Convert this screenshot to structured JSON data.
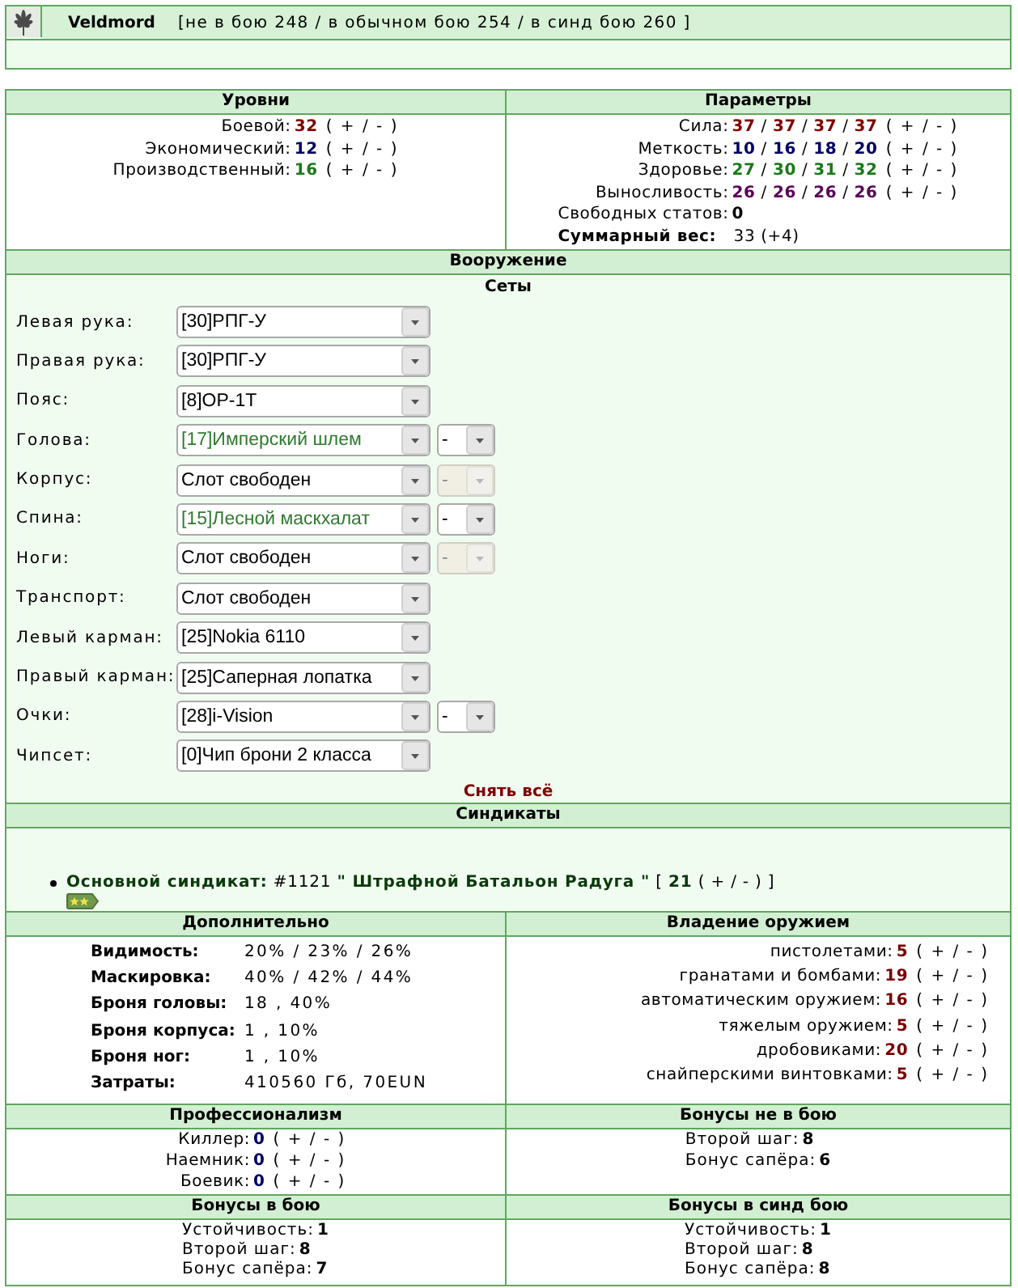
{
  "header": {
    "name": "Veldmord",
    "levels_text": "[не в бою 248 / в обычном бою 254 / в синд бою 260 ]"
  },
  "levels": {
    "title": "Уровни",
    "rows": [
      {
        "label": "Боевой:",
        "value": "32",
        "color": "#800000",
        "adjust": "( + / - )"
      },
      {
        "label": "Экономический:",
        "value": "12",
        "color": "#000066",
        "adjust": "( + / - )"
      },
      {
        "label": "Производственный:",
        "value": "16",
        "color": "#1a7a1a",
        "adjust": "( + / - )"
      }
    ]
  },
  "params": {
    "title": "Параметры",
    "stats": [
      {
        "label": "Сила:",
        "values": "**37** / **37** / **37** / **37**",
        "color": "#800000",
        "adjust": "( + / - )"
      },
      {
        "label": "Меткость:",
        "values": "**10** / **16** / **18** / **20**",
        "color": "#000066",
        "adjust": "( + / - )"
      },
      {
        "label": "Здоровье:",
        "values": "**27** / **30** / **31** / **32**",
        "color": "#1a7a1a",
        "adjust": "( + / - )"
      },
      {
        "label": "Выносливость:",
        "values": "**26** / **26** / **26** / **26**",
        "color": "#5a005a",
        "adjust": "( + / - )"
      }
    ],
    "free_stats": {
      "label": "Свободных статов:",
      "value": "0"
    },
    "total_weight": {
      "label": "Суммарный вес:",
      "value": "33 (+4)"
    }
  },
  "armament": {
    "title": "Вооружение",
    "sets_label": "Сеты",
    "slots": [
      {
        "label": "Левая рука:",
        "item": "[30]РПГ-У",
        "color": "#000000"
      },
      {
        "label": "Правая рука:",
        "item": "[30]РПГ-У",
        "color": "#000000"
      },
      {
        "label": "Пояс:",
        "item": "[8]ОР-1Т",
        "color": "#000000"
      },
      {
        "label": "Голова:",
        "item": "[17]Имперский шлем",
        "color": "#2f7a2f",
        "mod": {
          "value": "-",
          "disabled": false
        }
      },
      {
        "label": "Корпус:",
        "item": "Слот свободен",
        "color": "#000000",
        "mod": {
          "value": "-",
          "disabled": true
        }
      },
      {
        "label": "Спина:",
        "item": "[15]Лесной маскхалат",
        "color": "#2f7a2f",
        "mod": {
          "value": "-",
          "disabled": false
        }
      },
      {
        "label": "Ноги:",
        "item": "Слот свободен",
        "color": "#000000",
        "mod": {
          "value": "-",
          "disabled": true
        }
      },
      {
        "label": "Транспорт:",
        "item": "Слот свободен",
        "color": "#000000"
      },
      {
        "label": "Левый карман:",
        "item": "[25]Nokia 6110",
        "color": "#000000"
      },
      {
        "label": "Правый карман:",
        "item": "[25]Саперная лопатка",
        "color": "#000000"
      },
      {
        "label": "Очки:",
        "item": "[28]i-Vision",
        "color": "#000000",
        "mod": {
          "value": "-",
          "disabled": false
        }
      },
      {
        "label": "Чипсет:",
        "item": "[0]Чип брони 2 класса",
        "color": "#000000"
      }
    ],
    "remove_all": "Снять всё"
  },
  "syndicates": {
    "title": "Синдикаты",
    "items": [
      {
        "text": "**Основной синдикат:** #1121 **\" Штрафной Батальон Радуга \"** [ **21** ( + / - ) ]"
      }
    ]
  },
  "extra": {
    "title": "Дополнительно",
    "rows": [
      {
        "label": "Видимость:",
        "value": "20% / 23% / 26%"
      },
      {
        "label": "Маскировка:",
        "value": "40% / 42% / 44%"
      },
      {
        "label": "Броня головы:",
        "value": "18 , 40%"
      },
      {
        "label": "Броня корпуса:",
        "value": "1 , 10%"
      },
      {
        "label": "Броня ног:",
        "value": "1 , 10%"
      },
      {
        "label": "Затраты:",
        "value": "410560 Гб, 70EUN"
      }
    ]
  },
  "weapons": {
    "title": "Владение оружием",
    "rows": [
      {
        "label": "пистолетами:",
        "value": "5",
        "adjust": "( + / - )"
      },
      {
        "label": "гранатами и бомбами:",
        "value": "19",
        "adjust": "( + / - )"
      },
      {
        "label": "автоматическим оружием:",
        "value": "16",
        "adjust": "( + / - )"
      },
      {
        "label": "тяжелым оружием:",
        "value": "5",
        "adjust": "( + / - )"
      },
      {
        "label": "дробовиками:",
        "value": "20",
        "adjust": "( + / - )"
      },
      {
        "label": "снайперскими винтовками:",
        "value": "5",
        "adjust": "( + / - )"
      }
    ]
  },
  "professionalism": {
    "title": "Профессионализм",
    "rows": [
      {
        "label": "Киллер:",
        "value": "0",
        "adjust": "( + / - )"
      },
      {
        "label": "Наемник:",
        "value": "0",
        "adjust": "( + / - )"
      },
      {
        "label": "Боевик:",
        "value": "0",
        "adjust": "( + / - )"
      }
    ]
  },
  "bonus_peace": {
    "title": "Бонусы не в бою",
    "rows": [
      {
        "label": "Второй шаг:",
        "value": "8"
      },
      {
        "label": "Бонус сапёра:",
        "value": "6"
      }
    ]
  },
  "bonus_battle": {
    "title": "Бонусы в бою",
    "rows": [
      {
        "label": "Устойчивость:",
        "value": "1"
      },
      {
        "label": "Второй шаг:",
        "value": "8"
      },
      {
        "label": "Бонус сапёра:",
        "value": "7"
      }
    ]
  },
  "bonus_synd": {
    "title": "Бонусы в синд бою",
    "rows": [
      {
        "label": "Устойчивость:",
        "value": "1"
      },
      {
        "label": "Второй шаг:",
        "value": "8"
      },
      {
        "label": "Бонус сапёра:",
        "value": "8"
      }
    ]
  }
}
